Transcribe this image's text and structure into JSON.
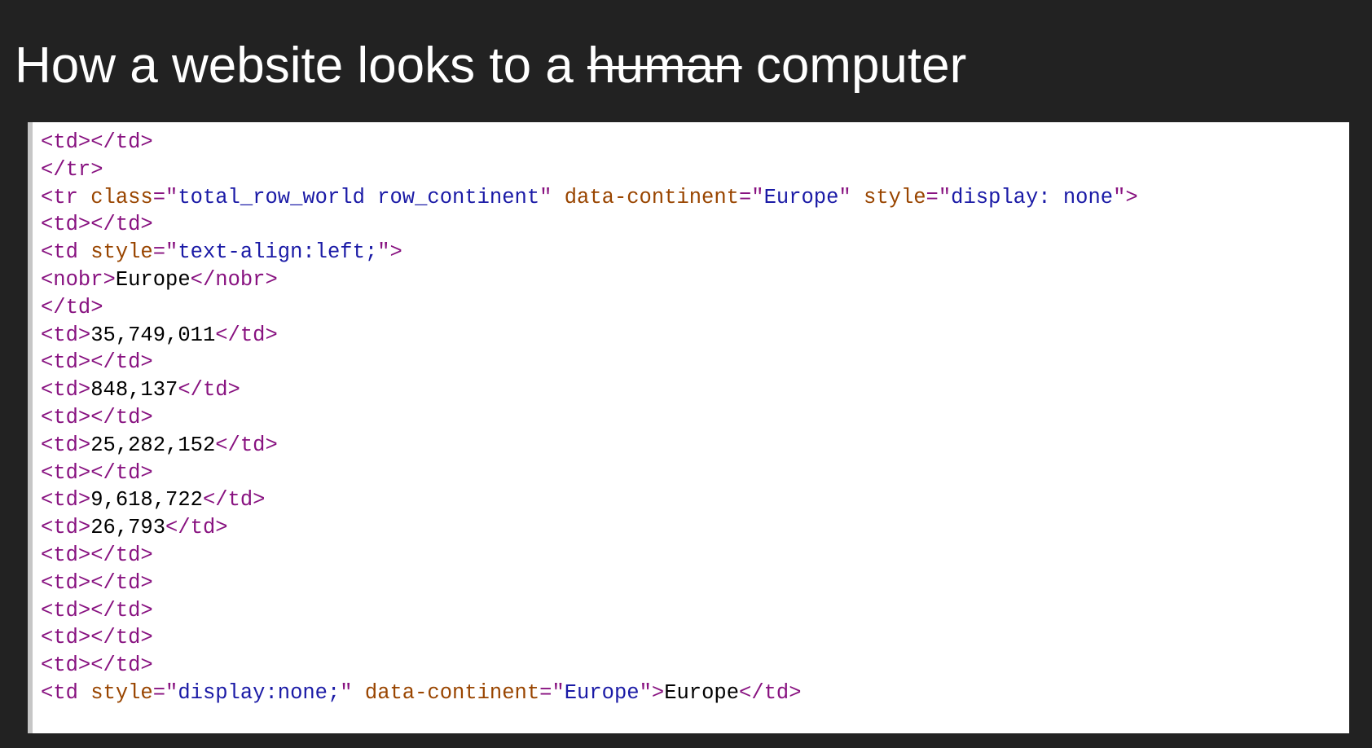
{
  "title": {
    "before": "How a website looks to a ",
    "struck": "human",
    "after": " computer"
  },
  "colors": {
    "background": "#222222",
    "tag": "#881280",
    "attribute_name": "#994500",
    "attribute_value": "#1a1aa6",
    "text": "#000000"
  },
  "code_lines": [
    [
      {
        "t": "tag",
        "s": "<td></td>"
      }
    ],
    [
      {
        "t": "tag",
        "s": "</tr>"
      }
    ],
    [
      {
        "t": "tag",
        "s": "<tr "
      },
      {
        "t": "attr",
        "s": "class"
      },
      {
        "t": "tag",
        "s": "=\""
      },
      {
        "t": "val",
        "s": "total_row_world row_continent"
      },
      {
        "t": "tag",
        "s": "\" "
      },
      {
        "t": "attr",
        "s": "data-continent"
      },
      {
        "t": "tag",
        "s": "=\""
      },
      {
        "t": "val",
        "s": "Europe"
      },
      {
        "t": "tag",
        "s": "\" "
      },
      {
        "t": "attr",
        "s": "style"
      },
      {
        "t": "tag",
        "s": "=\""
      },
      {
        "t": "val",
        "s": "display: none"
      },
      {
        "t": "tag",
        "s": "\">"
      }
    ],
    [
      {
        "t": "tag",
        "s": "<td></td>"
      }
    ],
    [
      {
        "t": "tag",
        "s": "<td "
      },
      {
        "t": "attr",
        "s": "style"
      },
      {
        "t": "tag",
        "s": "=\""
      },
      {
        "t": "val",
        "s": "text-align:left;"
      },
      {
        "t": "tag",
        "s": "\">"
      }
    ],
    [
      {
        "t": "tag",
        "s": "<nobr>"
      },
      {
        "t": "txt",
        "s": "Europe"
      },
      {
        "t": "tag",
        "s": "</nobr>"
      }
    ],
    [
      {
        "t": "tag",
        "s": "</td>"
      }
    ],
    [
      {
        "t": "tag",
        "s": "<td>"
      },
      {
        "t": "txt",
        "s": "35,749,011"
      },
      {
        "t": "tag",
        "s": "</td>"
      }
    ],
    [
      {
        "t": "tag",
        "s": "<td></td>"
      }
    ],
    [
      {
        "t": "tag",
        "s": "<td>"
      },
      {
        "t": "txt",
        "s": "848,137"
      },
      {
        "t": "tag",
        "s": "</td>"
      }
    ],
    [
      {
        "t": "tag",
        "s": "<td></td>"
      }
    ],
    [
      {
        "t": "tag",
        "s": "<td>"
      },
      {
        "t": "txt",
        "s": "25,282,152"
      },
      {
        "t": "tag",
        "s": "</td>"
      }
    ],
    [
      {
        "t": "tag",
        "s": "<td></td>"
      }
    ],
    [
      {
        "t": "tag",
        "s": "<td>"
      },
      {
        "t": "txt",
        "s": "9,618,722"
      },
      {
        "t": "tag",
        "s": "</td>"
      }
    ],
    [
      {
        "t": "tag",
        "s": "<td>"
      },
      {
        "t": "txt",
        "s": "26,793"
      },
      {
        "t": "tag",
        "s": "</td>"
      }
    ],
    [
      {
        "t": "tag",
        "s": "<td></td>"
      }
    ],
    [
      {
        "t": "tag",
        "s": "<td></td>"
      }
    ],
    [
      {
        "t": "tag",
        "s": "<td></td>"
      }
    ],
    [
      {
        "t": "tag",
        "s": "<td></td>"
      }
    ],
    [
      {
        "t": "tag",
        "s": "<td></td>"
      }
    ],
    [
      {
        "t": "tag",
        "s": "<td "
      },
      {
        "t": "attr",
        "s": "style"
      },
      {
        "t": "tag",
        "s": "=\""
      },
      {
        "t": "val",
        "s": "display:none;"
      },
      {
        "t": "tag",
        "s": "\" "
      },
      {
        "t": "attr",
        "s": "data-continent"
      },
      {
        "t": "tag",
        "s": "=\""
      },
      {
        "t": "val",
        "s": "Europe"
      },
      {
        "t": "tag",
        "s": "\">"
      },
      {
        "t": "txt",
        "s": "Europe"
      },
      {
        "t": "tag",
        "s": "</td>"
      }
    ]
  ]
}
